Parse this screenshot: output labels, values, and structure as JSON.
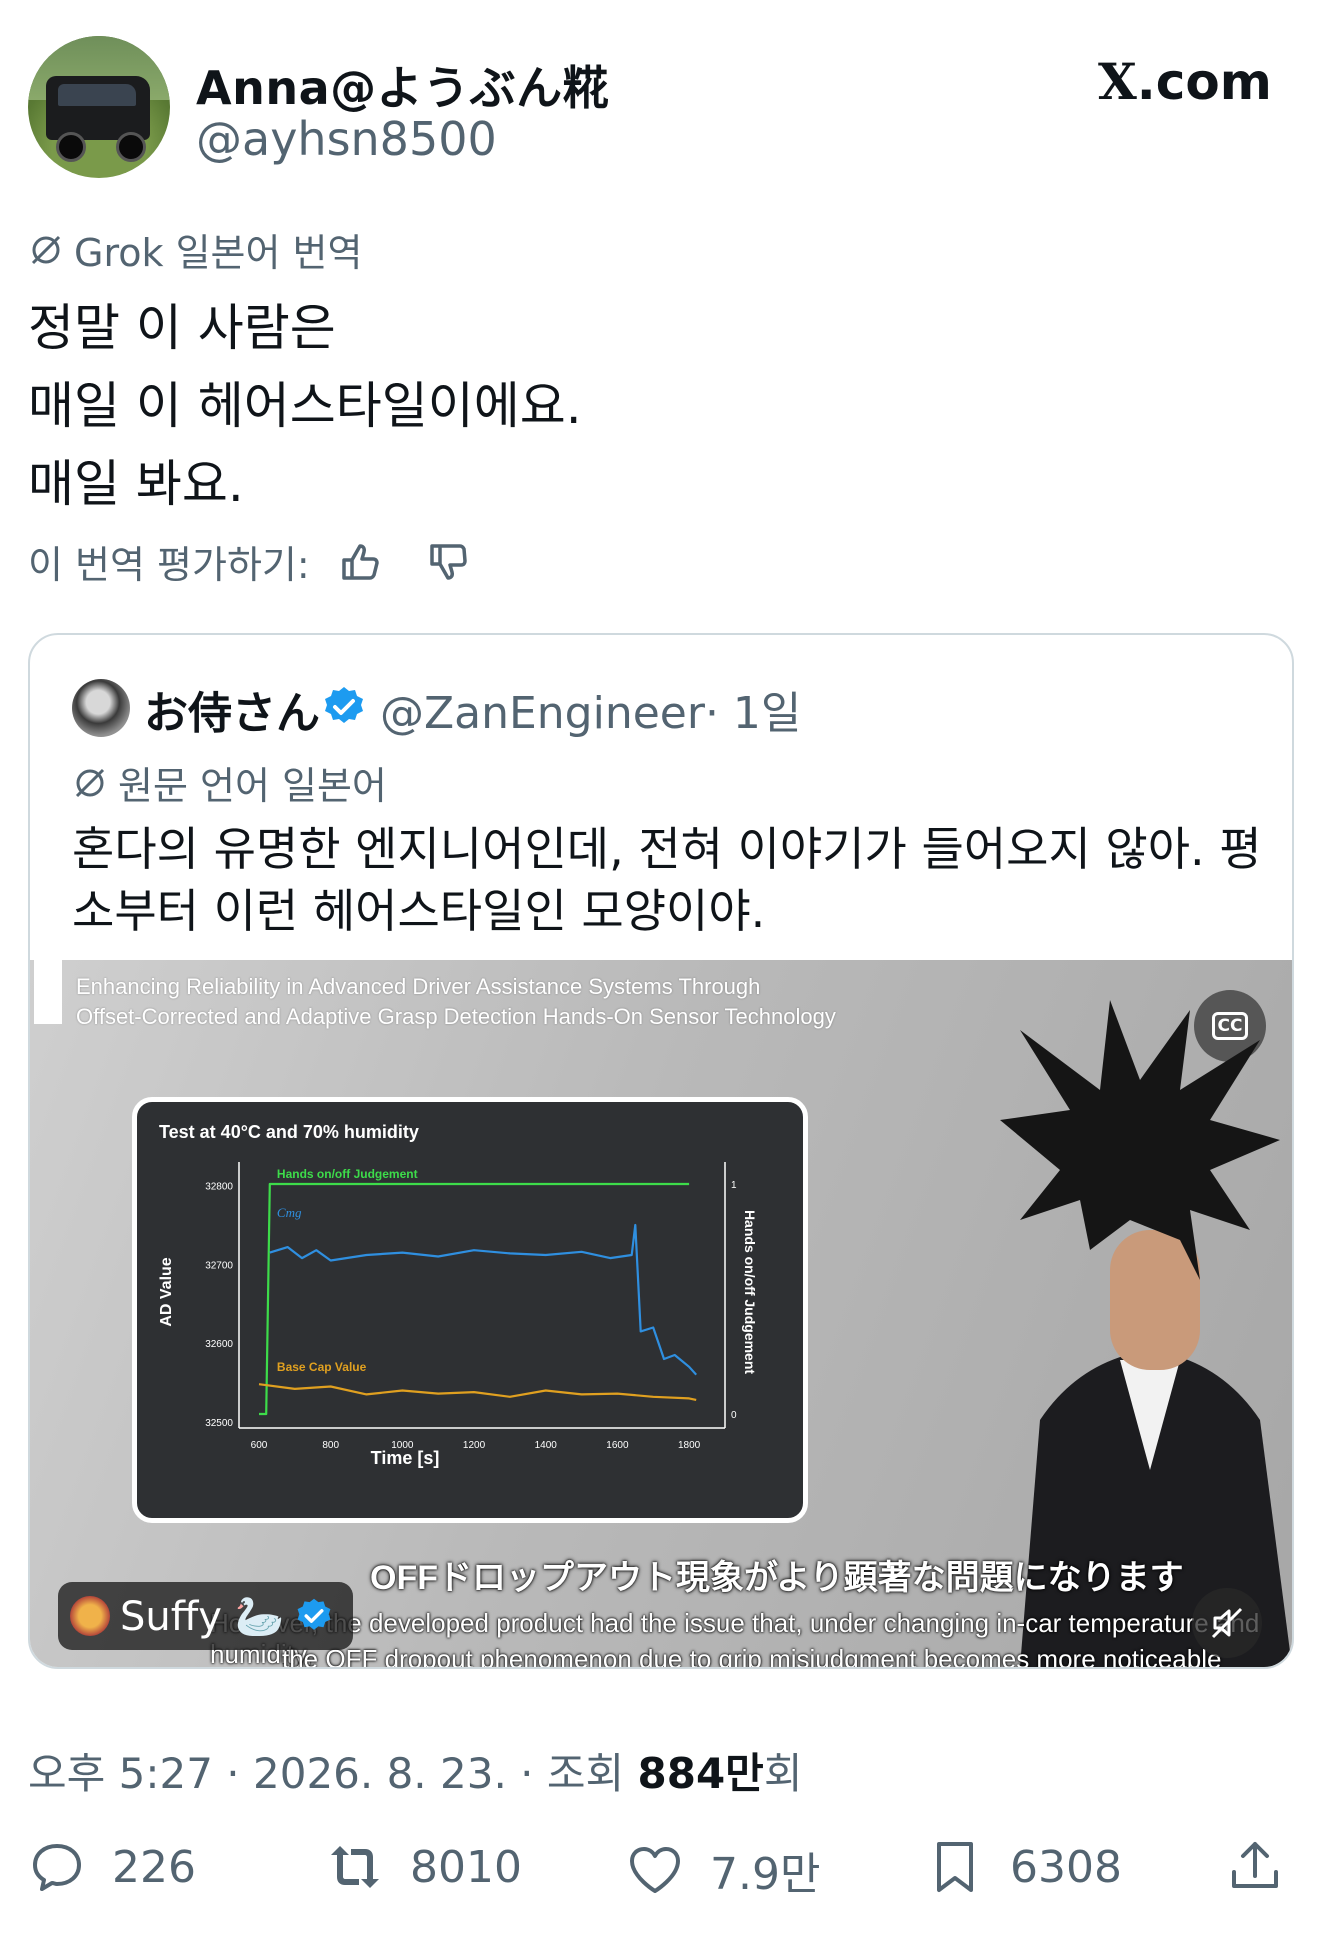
{
  "header": {
    "author_name": "Anna@ようぶん糀",
    "author_handle": "@ayhsn8500",
    "site": "X.com",
    "site_x": "X",
    "site_suffix": ".com"
  },
  "translation": {
    "label": "Grok 일본어 번역",
    "lines": [
      "정말 이 사람은",
      "매일 이 헤어스타일이에요.",
      "매일 봐요."
    ],
    "rate_label": "이 번역 평가하기:"
  },
  "quote": {
    "name": "お侍さん",
    "handle": "@ZanEngineer",
    "time": "· 1일",
    "source_label": "원문 언어 일본어",
    "lines": [
      "혼다의 유명한 엔지니어인데, 전혀 이야기가 들어오지 않아. 평",
      "소부터 이런 헤어스타일인 모양이야."
    ],
    "video": {
      "title_line1": "Enhancing Reliability in Advanced Driver Assistance Systems Through",
      "title_line2": "Offset-Corrected and Adaptive Grasp Detection Hands-On Sensor Technology",
      "cc_label": "CC",
      "subtitle_ja": "OFFドロップアウト現象がより顕著な問題になります",
      "subtitle_en1": "However, the developed product had the issue that, under changing in-car temperature and humidity,",
      "subtitle_en2": "the OFF dropout phenomenon due to grip misjudgment becomes more noticeable",
      "channel": "Suffy 🦢",
      "chart_title": "Test at 40°C and 70% humidity"
    }
  },
  "meta": {
    "time": "오후 5:27 · 2026. 8. 23. · 조회 ",
    "views": "884만",
    "views_suffix": "회"
  },
  "actions": {
    "replies": "226",
    "reposts": "8010",
    "likes": "7.9만",
    "bookmarks": "6308"
  },
  "colors": {
    "text": "#0f1419",
    "secondary": "#536471",
    "verified": "#1d9bf0",
    "border": "#cfd9de",
    "chart_green": "#3ddc4a",
    "chart_blue": "#2f8fe0",
    "chart_orange": "#e0a020"
  },
  "chart_data": {
    "type": "line",
    "title": "Test at 40°C and 70% humidity",
    "xlabel": "Time [s]",
    "ylabel": "AD Value",
    "y2label": "Hands on/off Judgement",
    "xlim": [
      600,
      1850
    ],
    "ylim": [
      32500,
      32830
    ],
    "xticks": [
      600,
      800,
      1000,
      1200,
      1400,
      1600,
      1800
    ],
    "yticks": [
      32500,
      32600,
      32700,
      32800
    ],
    "y2ticks": [
      0,
      1
    ],
    "series": [
      {
        "name": "Hands on/off Judgement",
        "color": "#3ddc4a",
        "axis": "y2",
        "x": [
          600,
          620,
          630,
          1800
        ],
        "y": [
          0,
          0,
          1,
          1
        ]
      },
      {
        "name": "Cтg",
        "color": "#2f8fe0",
        "axis": "y",
        "x": [
          630,
          680,
          720,
          760,
          800,
          900,
          1000,
          1100,
          1200,
          1300,
          1400,
          1500,
          1580,
          1640,
          1650,
          1665,
          1700,
          1730,
          1760,
          1800,
          1820
        ],
        "y": [
          32715,
          32722,
          32708,
          32718,
          32705,
          32712,
          32715,
          32710,
          32718,
          32714,
          32712,
          32716,
          32708,
          32712,
          32750,
          32615,
          32620,
          32580,
          32585,
          32570,
          32560
        ]
      },
      {
        "name": "Base Cap Value",
        "color": "#e0a020",
        "axis": "y",
        "x": [
          600,
          700,
          800,
          900,
          1000,
          1100,
          1200,
          1300,
          1400,
          1500,
          1600,
          1700,
          1800,
          1820
        ],
        "y": [
          32548,
          32542,
          32545,
          32535,
          32540,
          32536,
          32538,
          32532,
          32540,
          32535,
          32536,
          32532,
          32530,
          32528
        ]
      }
    ]
  }
}
